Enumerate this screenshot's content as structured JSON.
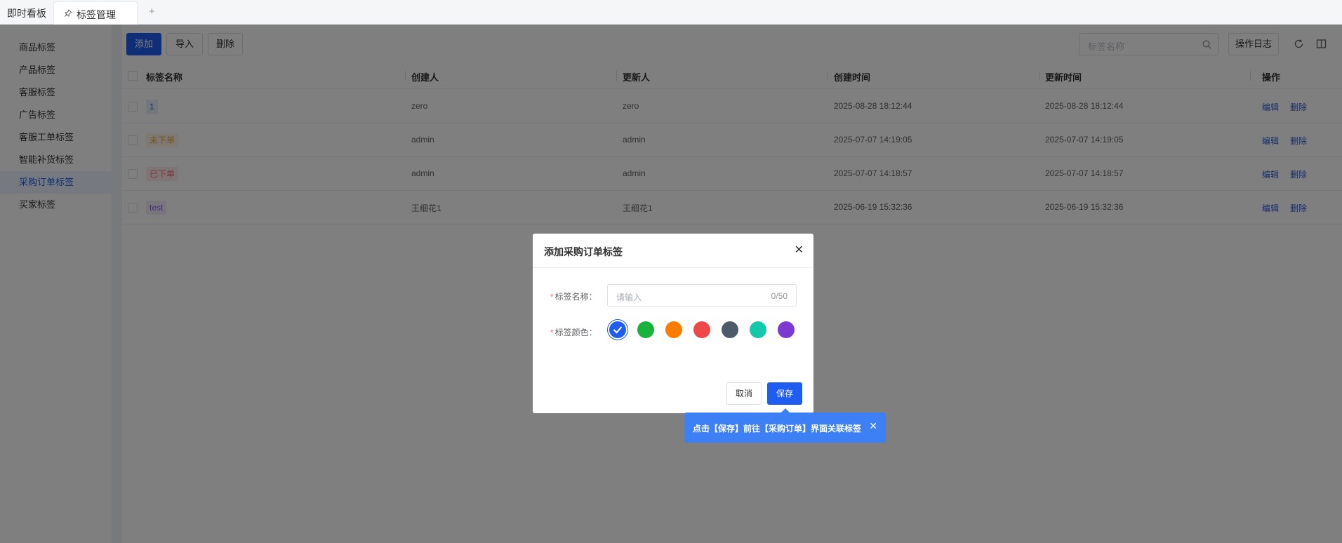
{
  "tabs": {
    "home_label": "即时看板",
    "active_label": "标签管理",
    "add_symbol": "+"
  },
  "sidebar": {
    "items": [
      {
        "label": "商品标签"
      },
      {
        "label": "产品标签"
      },
      {
        "label": "客服标签"
      },
      {
        "label": "广告标签"
      },
      {
        "label": "客服工单标签"
      },
      {
        "label": "智能补货标签"
      },
      {
        "label": "采购订单标签",
        "active": true
      },
      {
        "label": "买家标签"
      }
    ]
  },
  "toolbar": {
    "add_label": "添加",
    "import_label": "导入",
    "delete_label": "删除",
    "search_placeholder": "标签名称",
    "log_label": "操作日志"
  },
  "table": {
    "columns": [
      "标签名称",
      "创建人",
      "更新人",
      "创建时间",
      "更新时间",
      "操作"
    ],
    "rows": [
      {
        "tag": "1",
        "tag_color": "#2a5bd7",
        "creator": "zero",
        "updater": "zero",
        "created": "2025-08-28 18:12:44",
        "updated": "2025-08-28 18:12:44"
      },
      {
        "tag": "未下单",
        "tag_color": "#e6a23c",
        "creator": "admin",
        "updater": "admin",
        "created": "2025-07-07 14:19:05",
        "updated": "2025-07-07 14:19:05"
      },
      {
        "tag": "已下单",
        "tag_color": "#f56c6c",
        "creator": "admin",
        "updater": "admin",
        "created": "2025-07-07 14:18:57",
        "updated": "2025-07-07 14:18:57"
      },
      {
        "tag": "test",
        "tag_color": "#8a5cd6",
        "creator": "王细花1",
        "updater": "王细花1",
        "created": "2025-06-19 15:32:36",
        "updated": "2025-06-19 15:32:36"
      }
    ],
    "edit_label": "编辑",
    "delete_label": "删除"
  },
  "dialog": {
    "title": "添加采购订单标签",
    "name_label": "标签名称：",
    "name_placeholder": "请输入",
    "name_count": "0/50",
    "color_label": "标签颜色：",
    "colors": [
      "#1f5cf0",
      "#19b23b",
      "#fa7d00",
      "#f04848",
      "#4e5969",
      "#14c9a9",
      "#7d3ad1"
    ],
    "selected_color": "#1f5cf0",
    "cancel_label": "取消",
    "save_label": "保存"
  },
  "tooltip": {
    "text": "点击【保存】前往【采购订单】界面关联标签"
  }
}
